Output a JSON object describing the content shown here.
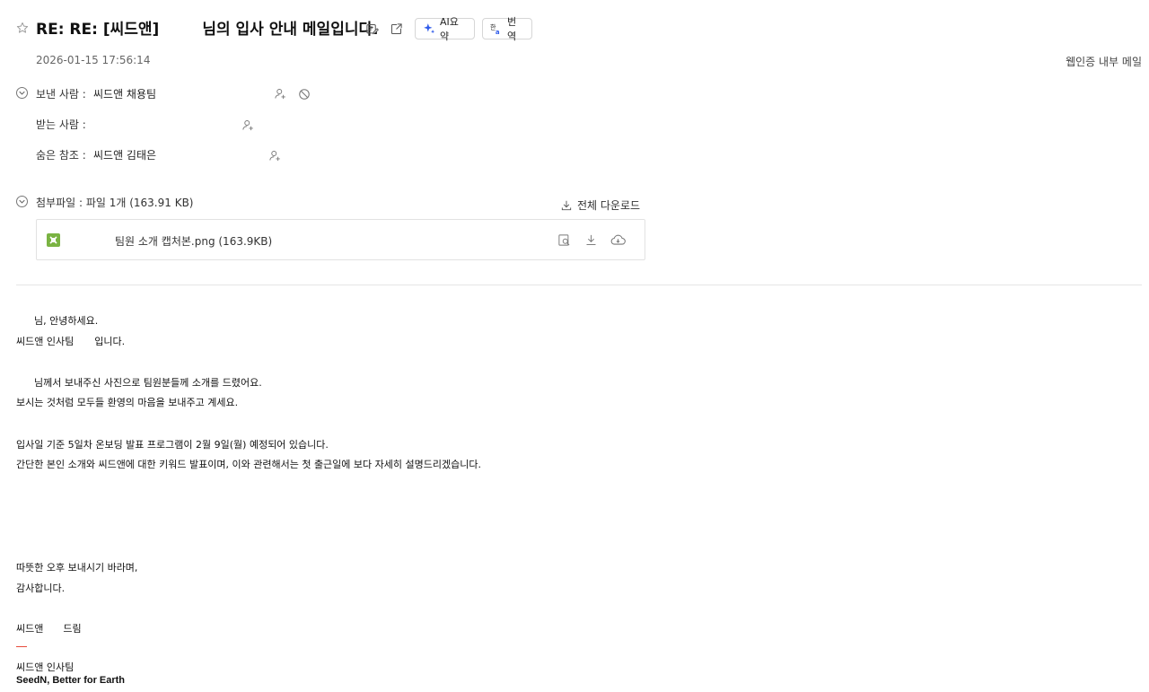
{
  "header": {
    "subject_part1": "RE: RE: [씨드앤]",
    "subject_part2": "님의 입사 안내 메일입니다.",
    "ai_summary_label": "AI요약",
    "translate_label": "번역",
    "date": "2026-01-15 17:56:14",
    "auth_label": "웹인증 내부 메일"
  },
  "people": {
    "from_label": "보낸 사람 :",
    "from_value": "씨드앤 채용팀",
    "to_label": "받는 사람 :",
    "to_value": "",
    "bcc_label": "숨은 참조 :",
    "bcc_value": "씨드앤 김태은"
  },
  "attachments": {
    "summary": "첨부파일 : 파일 1개 (163.91 KB)",
    "download_all_label": "전체 다운로드",
    "files": [
      {
        "name": "팀원 소개 캡처본.png (163.9KB)"
      }
    ]
  },
  "body": {
    "greeting": "님, 안녕하세요.",
    "line2_a": "씨드앤 인사팀",
    "line2_b": "입니다.",
    "line3": "님께서 보내주신 사진으로 팀원분들께 소개를 드렸어요.",
    "line4": "보시는 것처럼 모두들 환영의 마음을 보내주고 계세요.",
    "line5": "입사일 기준 5일차 온보딩 발표 프로그램이 2월 9일(월) 예정되어 있습니다.",
    "line6": "간단한 본인 소개와 씨드앤에 대한 키워드 발표이며, 이와 관련해서는 첫 출근일에 보다 자세히 설명드리겠습니다.",
    "closing1": "따뜻한 오후 보내시기 바라며,",
    "closing2": "감사합니다.",
    "sign_a": "씨드앤",
    "sign_b": "드림",
    "sig_team": "씨드앤 인사팀",
    "sig_brand": "SeedN, Better for Earth"
  },
  "colors": {
    "accent_blue": "#2f5bea",
    "file_green": "#7ab342",
    "sig_red": "#e74c3c"
  }
}
